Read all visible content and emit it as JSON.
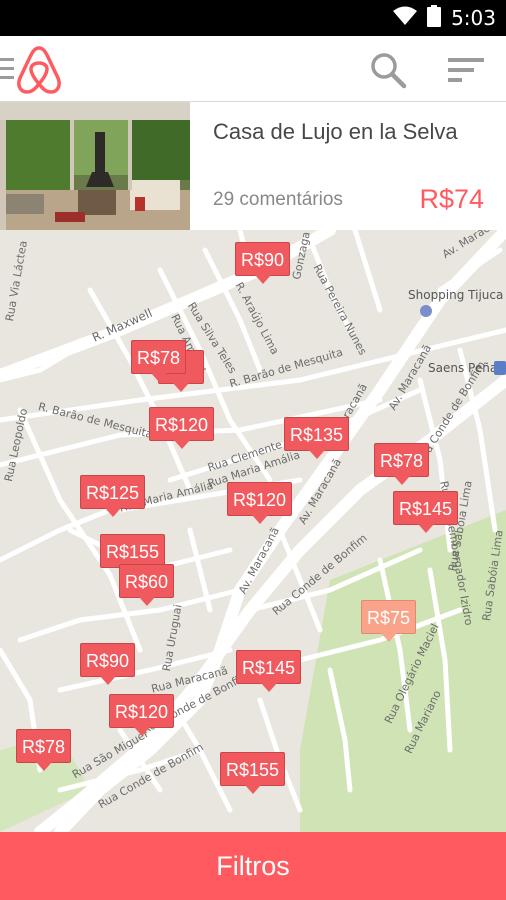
{
  "status_bar": {
    "time": "5:03",
    "icons": [
      "wifi-icon",
      "battery-icon"
    ]
  },
  "app_bar": {
    "icons": [
      "menu-icon",
      "airbnb-logo",
      "search-icon",
      "sort-icon"
    ]
  },
  "listing": {
    "title": "Casa de Lujo en la Selva",
    "reviews": "29 comentários",
    "price": "R$74",
    "price_color": "#ff5a5f"
  },
  "map": {
    "street_labels": [
      "Gonzaga Bastos",
      "Rua Pereira Nunes",
      "Av. Maraca",
      "Rua Via Láctea",
      "R. Maxwell",
      "Rua Silva Teles",
      "R. Araújo Lima",
      "Rua Amaral",
      "R. Barão de Mesquita",
      "R. Barão de Mesquita",
      "Rua Leopoldo",
      "Rua Clemente Falcão",
      "Rua Maria Amália",
      "Av. Maracanã",
      "Av. Maracanã",
      "Av. Maracanã",
      "Rua Conde de Bonfim",
      "Rua Maria Amália",
      "Av. Maracanã",
      "Rua Conde de Bonfim",
      "Rua Conde de Bonfim",
      "Rua Desembargador Izidro",
      "Rua Sabóia Lima",
      "Rua Sabóia Lima",
      "Rua Olegário Maciel",
      "Rua Mariano",
      "Rua São Miguel",
      "Rua Conde de Bonfim",
      "Rua Uruguai",
      "Rua Maracanã"
    ],
    "place_labels": [
      "Shopping Tijuca",
      "Saens Peña"
    ],
    "pins": [
      {
        "label": "R$90",
        "viewed": false
      },
      {
        "label": "R$78",
        "viewed": false
      },
      {
        "label": "R$120",
        "viewed": false
      },
      {
        "label": "R$135",
        "viewed": false
      },
      {
        "label": "R$78",
        "viewed": false
      },
      {
        "label": "R$125",
        "viewed": false
      },
      {
        "label": "R$120",
        "viewed": false
      },
      {
        "label": "R$145",
        "viewed": false
      },
      {
        "label": "R$155",
        "viewed": false
      },
      {
        "label": "R$60",
        "viewed": false
      },
      {
        "label": "R$75",
        "viewed": true
      },
      {
        "label": "R$90",
        "viewed": false
      },
      {
        "label": "R$145",
        "viewed": false
      },
      {
        "label": "R$120",
        "viewed": false
      },
      {
        "label": "R$78",
        "viewed": false
      },
      {
        "label": "R$155",
        "viewed": false
      }
    ],
    "pin_color": "#f05a5f",
    "viewed_pin_color": "#f9a48a"
  },
  "filters": {
    "label": "Filtros"
  }
}
